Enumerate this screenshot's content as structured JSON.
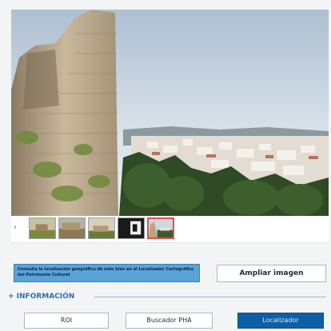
{
  "image_viewer": {
    "main_image_subject": "castle-ruin-and-town",
    "thumbnails": [
      {
        "name": "thumb-1",
        "active": false
      },
      {
        "name": "thumb-2",
        "active": false
      },
      {
        "name": "thumb-3",
        "active": false
      },
      {
        "name": "thumb-4",
        "active": false
      },
      {
        "name": "thumb-5",
        "active": true
      }
    ],
    "prev_icon": "chevron-left-icon"
  },
  "info_link": {
    "text": "Consulta la localización geográfica de este bien en el Localizador Cartográfico del Patrimonio Cultural"
  },
  "buttons": {
    "ampliar": "Ampliar imagen",
    "roi": "ROI",
    "buscador": "Buscador PHA",
    "localizador": "Localizador"
  },
  "section": {
    "title": "+ INFORMACIÓN"
  },
  "colors": {
    "accent": "#2f6fa8",
    "info_box": "#5aa3d8",
    "primary_button": "#0f5fa6",
    "active_thumb_border": "#d9534f"
  }
}
